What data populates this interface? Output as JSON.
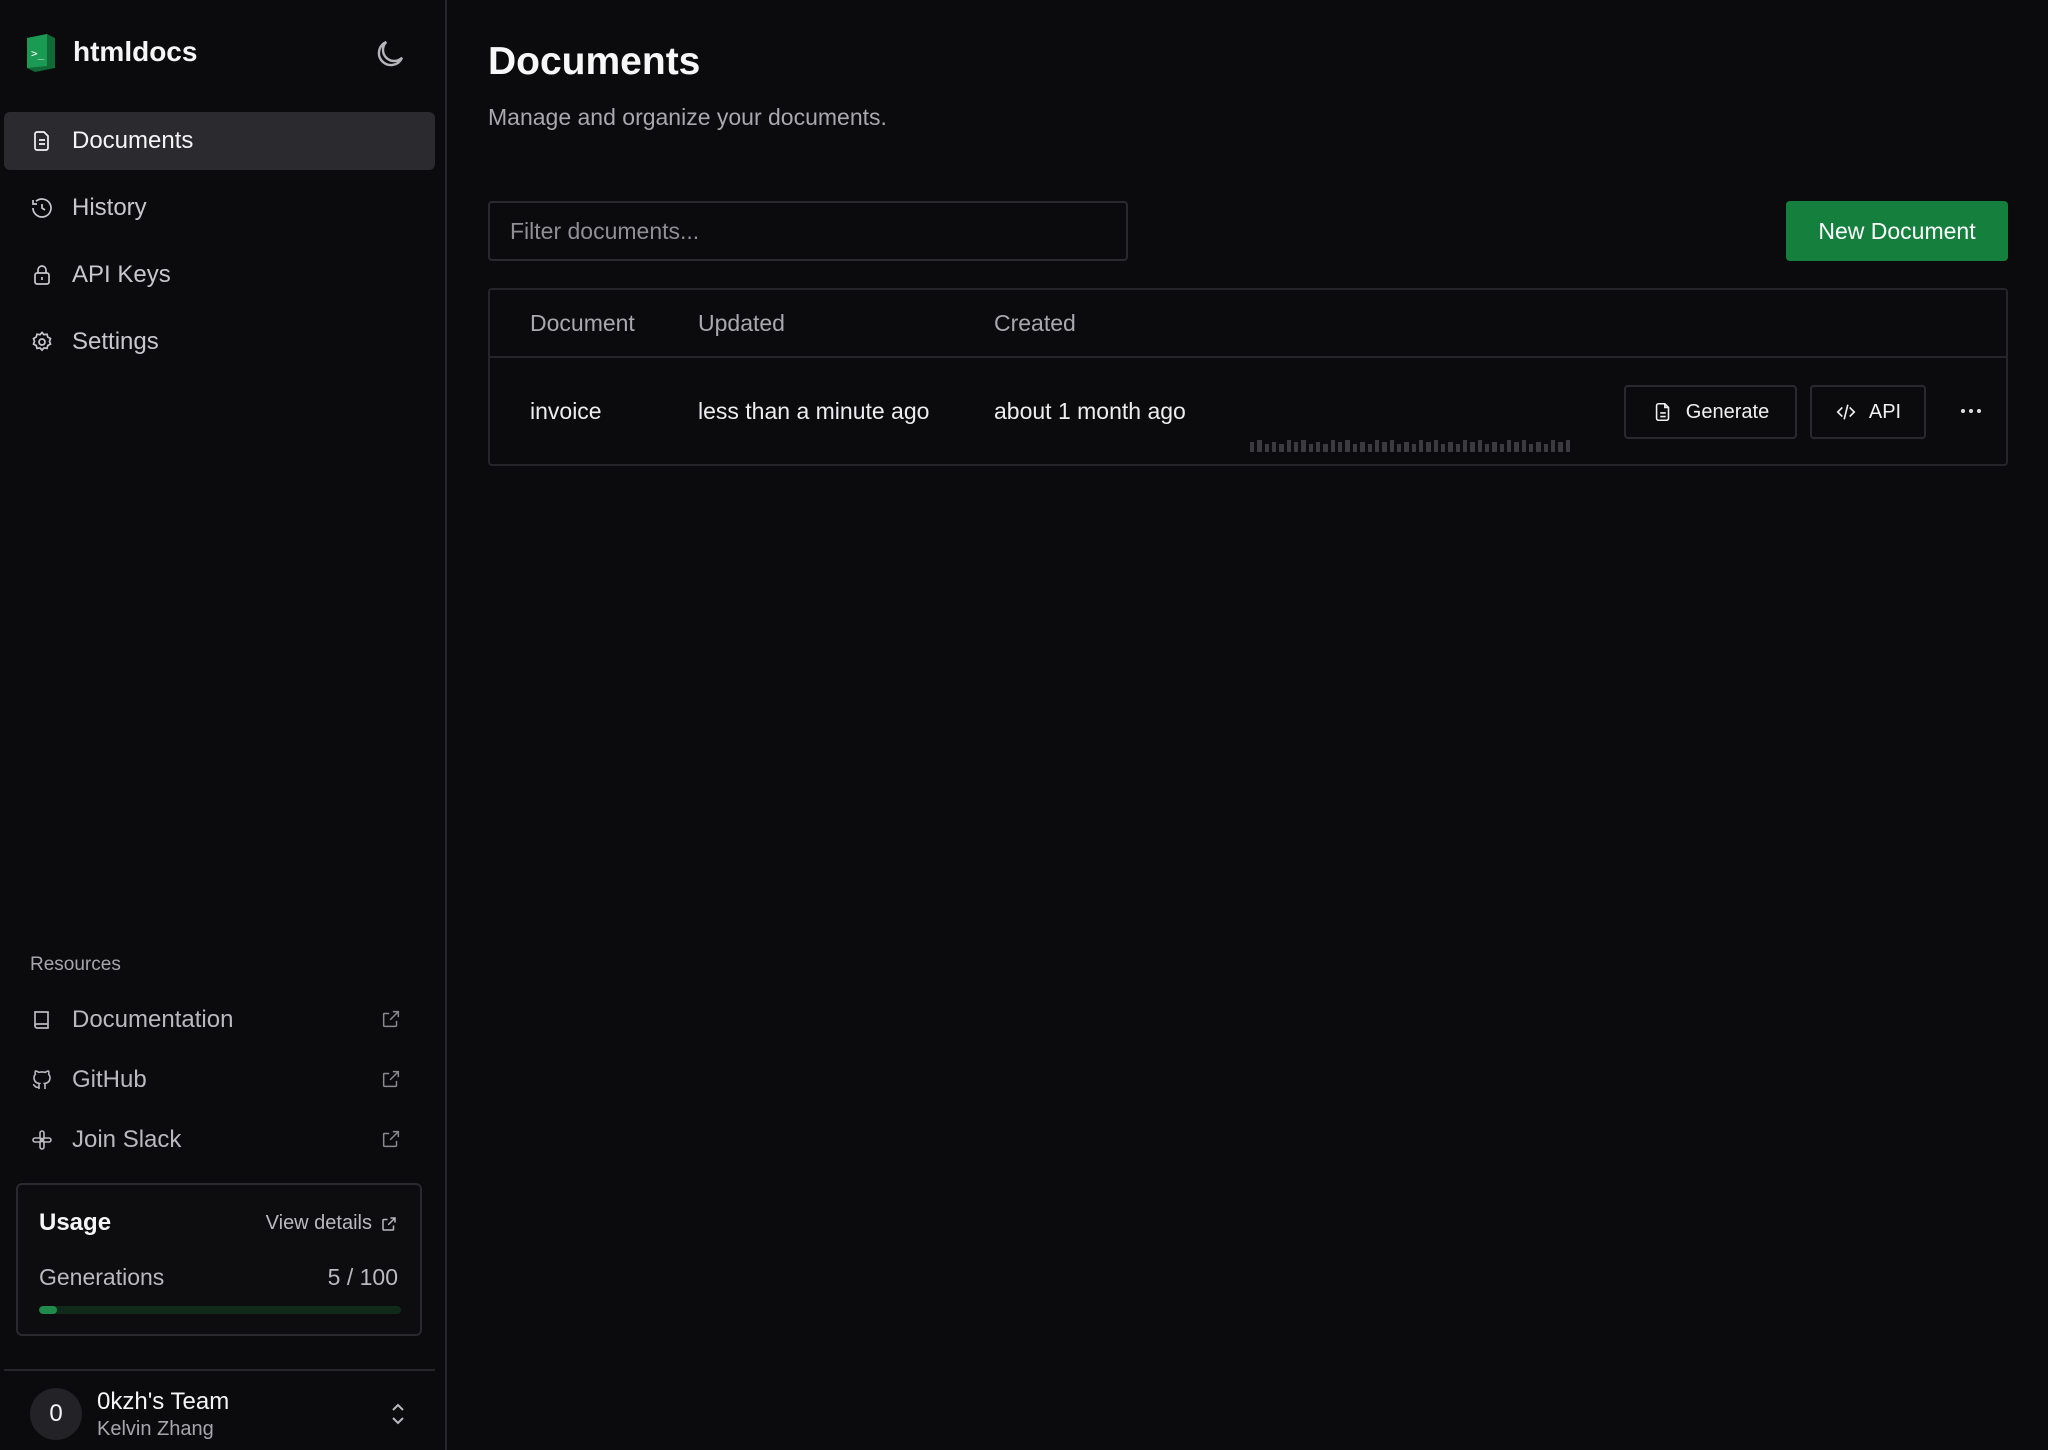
{
  "app": {
    "name": "htmldocs",
    "accent": "#15803d"
  },
  "sidebar": {
    "items": [
      {
        "label": "Documents",
        "icon": "document-icon",
        "active": true
      },
      {
        "label": "History",
        "icon": "history-icon",
        "active": false
      },
      {
        "label": "API Keys",
        "icon": "lock-icon",
        "active": false
      },
      {
        "label": "Settings",
        "icon": "gear-icon",
        "active": false
      }
    ],
    "resources_label": "Resources",
    "resources": [
      {
        "label": "Documentation",
        "icon": "book-icon"
      },
      {
        "label": "GitHub",
        "icon": "github-icon"
      },
      {
        "label": "Join Slack",
        "icon": "slack-icon"
      }
    ],
    "usage": {
      "title": "Usage",
      "link": "View details",
      "label": "Generations",
      "count": "5 / 100",
      "used": 5,
      "limit": 100
    },
    "team": {
      "avatar": "0",
      "name": "0kzh's Team",
      "user": "Kelvin Zhang"
    }
  },
  "main": {
    "title": "Documents",
    "subtitle": "Manage and organize your documents.",
    "filter_placeholder": "Filter documents...",
    "new_button": "New Document",
    "table": {
      "headers": [
        "Document",
        "Updated",
        "Created"
      ],
      "rows": [
        {
          "document": "invoice",
          "updated": "less than a minute ago",
          "created": "about 1 month ago",
          "generate_label": "Generate",
          "api_label": "API"
        }
      ]
    }
  }
}
